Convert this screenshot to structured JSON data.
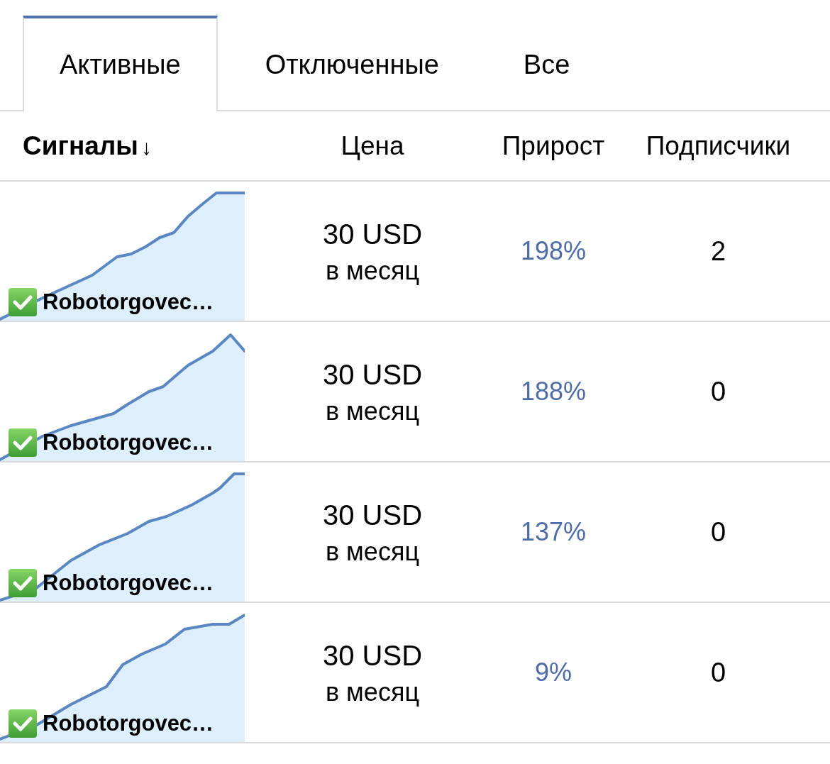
{
  "tabs": [
    {
      "label": "Активные",
      "selected": true
    },
    {
      "label": "Отключенные",
      "selected": false
    },
    {
      "label": "Все",
      "selected": false
    }
  ],
  "table": {
    "columns": [
      {
        "label": "Сигналы",
        "sorted": true,
        "sort_arrow": "↓"
      },
      {
        "label": "Цена",
        "sorted": false
      },
      {
        "label": "Прирост",
        "sorted": false
      },
      {
        "label": "Подписчики",
        "sorted": false
      }
    ],
    "rows": [
      {
        "signal": "Robotorgovec…",
        "verified": true,
        "price": "30 USD",
        "period": "в месяц",
        "growth": "198%",
        "subscribers": "2"
      },
      {
        "signal": "Robotorgovec…",
        "verified": true,
        "price": "30 USD",
        "period": "в месяц",
        "growth": "188%",
        "subscribers": "0"
      },
      {
        "signal": "Robotorgovec…",
        "verified": true,
        "price": "30 USD",
        "period": "в месяц",
        "growth": "137%",
        "subscribers": "0"
      },
      {
        "signal": "Robotorgovec…",
        "verified": true,
        "price": "30 USD",
        "period": "в месяц",
        "growth": "9%",
        "subscribers": "0"
      }
    ]
  }
}
